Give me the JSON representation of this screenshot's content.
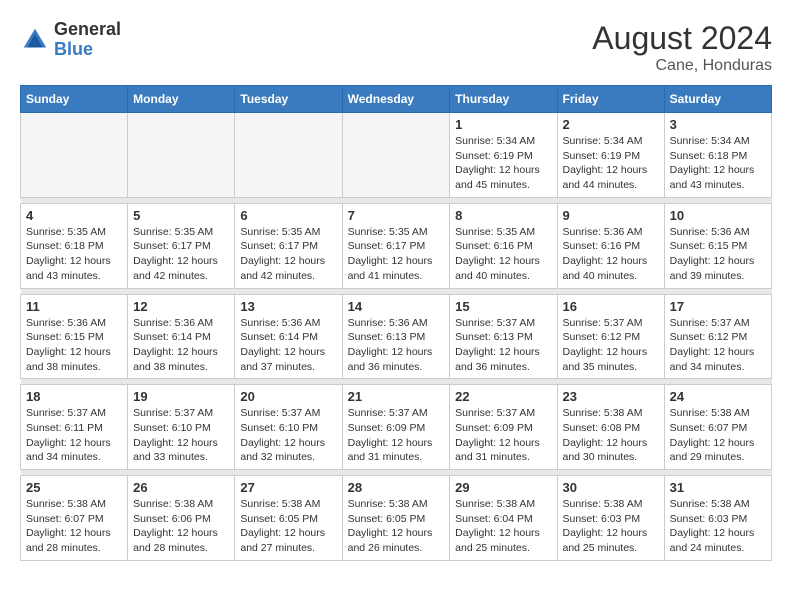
{
  "header": {
    "logo": {
      "general": "General",
      "blue": "Blue"
    },
    "title": "August 2024",
    "subtitle": "Cane, Honduras"
  },
  "calendar": {
    "days_of_week": [
      "Sunday",
      "Monday",
      "Tuesday",
      "Wednesday",
      "Thursday",
      "Friday",
      "Saturday"
    ],
    "weeks": [
      [
        {
          "day": "",
          "info": ""
        },
        {
          "day": "",
          "info": ""
        },
        {
          "day": "",
          "info": ""
        },
        {
          "day": "",
          "info": ""
        },
        {
          "day": "1",
          "info": "Sunrise: 5:34 AM\nSunset: 6:19 PM\nDaylight: 12 hours\nand 45 minutes."
        },
        {
          "day": "2",
          "info": "Sunrise: 5:34 AM\nSunset: 6:19 PM\nDaylight: 12 hours\nand 44 minutes."
        },
        {
          "day": "3",
          "info": "Sunrise: 5:34 AM\nSunset: 6:18 PM\nDaylight: 12 hours\nand 43 minutes."
        }
      ],
      [
        {
          "day": "4",
          "info": "Sunrise: 5:35 AM\nSunset: 6:18 PM\nDaylight: 12 hours\nand 43 minutes."
        },
        {
          "day": "5",
          "info": "Sunrise: 5:35 AM\nSunset: 6:17 PM\nDaylight: 12 hours\nand 42 minutes."
        },
        {
          "day": "6",
          "info": "Sunrise: 5:35 AM\nSunset: 6:17 PM\nDaylight: 12 hours\nand 42 minutes."
        },
        {
          "day": "7",
          "info": "Sunrise: 5:35 AM\nSunset: 6:17 PM\nDaylight: 12 hours\nand 41 minutes."
        },
        {
          "day": "8",
          "info": "Sunrise: 5:35 AM\nSunset: 6:16 PM\nDaylight: 12 hours\nand 40 minutes."
        },
        {
          "day": "9",
          "info": "Sunrise: 5:36 AM\nSunset: 6:16 PM\nDaylight: 12 hours\nand 40 minutes."
        },
        {
          "day": "10",
          "info": "Sunrise: 5:36 AM\nSunset: 6:15 PM\nDaylight: 12 hours\nand 39 minutes."
        }
      ],
      [
        {
          "day": "11",
          "info": "Sunrise: 5:36 AM\nSunset: 6:15 PM\nDaylight: 12 hours\nand 38 minutes."
        },
        {
          "day": "12",
          "info": "Sunrise: 5:36 AM\nSunset: 6:14 PM\nDaylight: 12 hours\nand 38 minutes."
        },
        {
          "day": "13",
          "info": "Sunrise: 5:36 AM\nSunset: 6:14 PM\nDaylight: 12 hours\nand 37 minutes."
        },
        {
          "day": "14",
          "info": "Sunrise: 5:36 AM\nSunset: 6:13 PM\nDaylight: 12 hours\nand 36 minutes."
        },
        {
          "day": "15",
          "info": "Sunrise: 5:37 AM\nSunset: 6:13 PM\nDaylight: 12 hours\nand 36 minutes."
        },
        {
          "day": "16",
          "info": "Sunrise: 5:37 AM\nSunset: 6:12 PM\nDaylight: 12 hours\nand 35 minutes."
        },
        {
          "day": "17",
          "info": "Sunrise: 5:37 AM\nSunset: 6:12 PM\nDaylight: 12 hours\nand 34 minutes."
        }
      ],
      [
        {
          "day": "18",
          "info": "Sunrise: 5:37 AM\nSunset: 6:11 PM\nDaylight: 12 hours\nand 34 minutes."
        },
        {
          "day": "19",
          "info": "Sunrise: 5:37 AM\nSunset: 6:10 PM\nDaylight: 12 hours\nand 33 minutes."
        },
        {
          "day": "20",
          "info": "Sunrise: 5:37 AM\nSunset: 6:10 PM\nDaylight: 12 hours\nand 32 minutes."
        },
        {
          "day": "21",
          "info": "Sunrise: 5:37 AM\nSunset: 6:09 PM\nDaylight: 12 hours\nand 31 minutes."
        },
        {
          "day": "22",
          "info": "Sunrise: 5:37 AM\nSunset: 6:09 PM\nDaylight: 12 hours\nand 31 minutes."
        },
        {
          "day": "23",
          "info": "Sunrise: 5:38 AM\nSunset: 6:08 PM\nDaylight: 12 hours\nand 30 minutes."
        },
        {
          "day": "24",
          "info": "Sunrise: 5:38 AM\nSunset: 6:07 PM\nDaylight: 12 hours\nand 29 minutes."
        }
      ],
      [
        {
          "day": "25",
          "info": "Sunrise: 5:38 AM\nSunset: 6:07 PM\nDaylight: 12 hours\nand 28 minutes."
        },
        {
          "day": "26",
          "info": "Sunrise: 5:38 AM\nSunset: 6:06 PM\nDaylight: 12 hours\nand 28 minutes."
        },
        {
          "day": "27",
          "info": "Sunrise: 5:38 AM\nSunset: 6:05 PM\nDaylight: 12 hours\nand 27 minutes."
        },
        {
          "day": "28",
          "info": "Sunrise: 5:38 AM\nSunset: 6:05 PM\nDaylight: 12 hours\nand 26 minutes."
        },
        {
          "day": "29",
          "info": "Sunrise: 5:38 AM\nSunset: 6:04 PM\nDaylight: 12 hours\nand 25 minutes."
        },
        {
          "day": "30",
          "info": "Sunrise: 5:38 AM\nSunset: 6:03 PM\nDaylight: 12 hours\nand 25 minutes."
        },
        {
          "day": "31",
          "info": "Sunrise: 5:38 AM\nSunset: 6:03 PM\nDaylight: 12 hours\nand 24 minutes."
        }
      ]
    ]
  }
}
